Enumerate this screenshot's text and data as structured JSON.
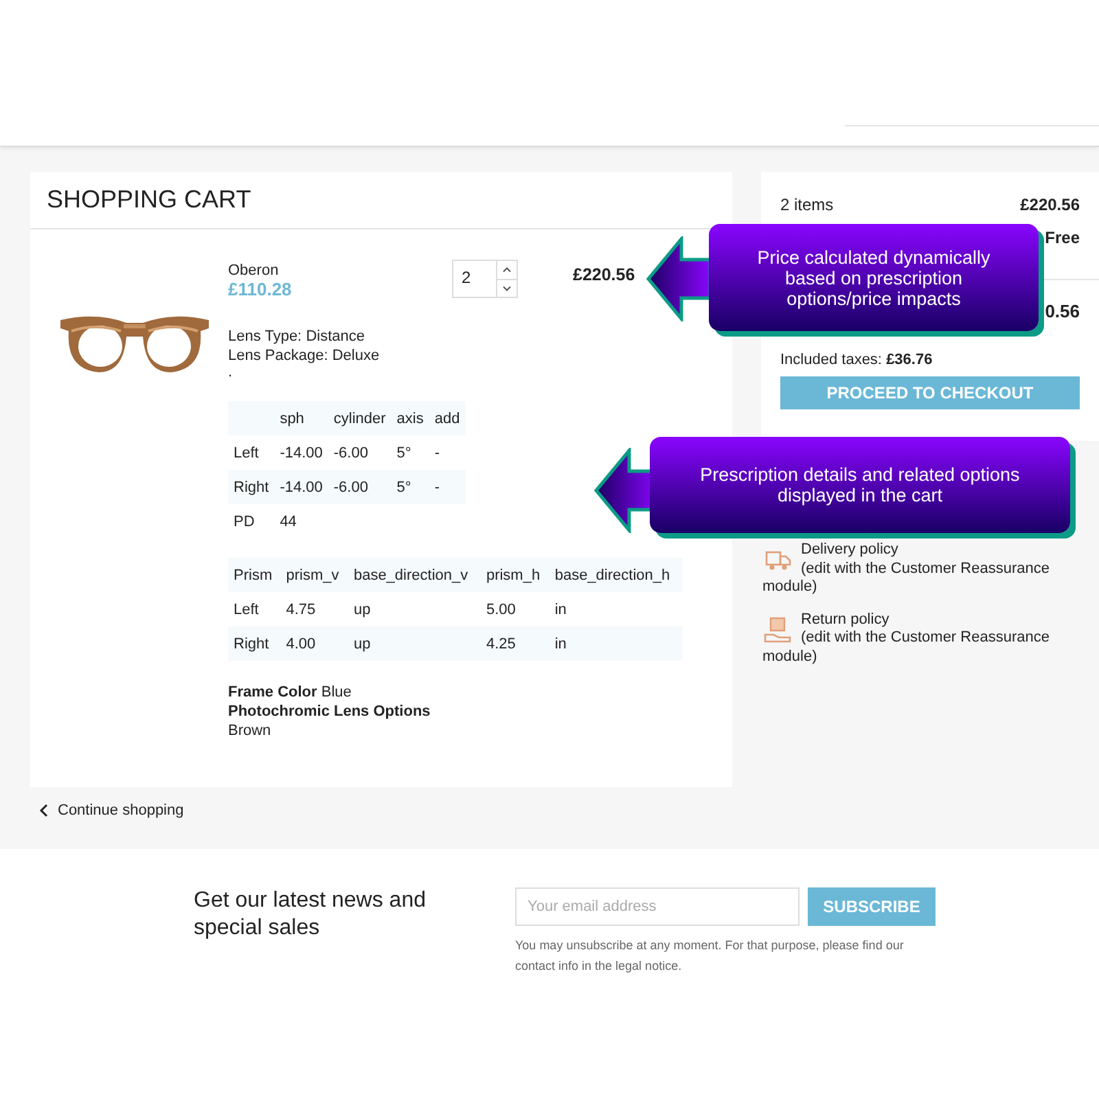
{
  "cart": {
    "title": "SHOPPING CART",
    "items": [
      {
        "name": "Oberon",
        "unit_price": "£110.28",
        "quantity": "2",
        "total": "£220.56",
        "attributes": [
          {
            "label": "Lens Type:",
            "value": "Distance"
          },
          {
            "label": "Lens Package:",
            "value": "Deluxe"
          }
        ],
        "separator": ".",
        "prescription": {
          "columns": [
            "sph",
            "cylinder",
            "axis",
            "add"
          ],
          "rows": [
            {
              "eye": "Left",
              "values": [
                "-14.00",
                "-6.00",
                "5°",
                "-"
              ]
            },
            {
              "eye": "Right",
              "values": [
                "-14.00",
                "-6.00",
                "5°",
                "-"
              ]
            }
          ],
          "pd": {
            "label": "PD",
            "value": "44"
          }
        },
        "prism": {
          "columns": [
            "Prism",
            "prism_v",
            "base_direction_v",
            "prism_h",
            "base_direction_h"
          ],
          "rows": [
            [
              "Left",
              "4.75",
              "up",
              "5.00",
              "in"
            ],
            [
              "Right",
              "4.00",
              "up",
              "4.25",
              "in"
            ]
          ]
        },
        "options": [
          {
            "kind": "inline",
            "label": "Frame Color",
            "value": "Blue"
          },
          {
            "kind": "block",
            "label": "Photochromic Lens Options",
            "value": "Brown"
          }
        ]
      }
    ]
  },
  "continue_link": "Continue shopping",
  "summary": {
    "rows": [
      {
        "kind": "items",
        "label": "2 items",
        "value": "£220.56"
      },
      {
        "kind": "shipping",
        "value": "Free"
      },
      {
        "kind": "total",
        "value": "0.56"
      }
    ],
    "taxes_label": "Included taxes:",
    "taxes_value": "£36.76",
    "checkout": "PROCEED TO CHECKOUT"
  },
  "reassurance": [
    {
      "kind": "delivery",
      "title": "Delivery policy",
      "note": "(edit with the Customer Reassurance module)"
    },
    {
      "kind": "return",
      "title": "Return policy",
      "note": "(edit with the Customer Reassurance module)"
    }
  ],
  "newsletter": {
    "heading": "Get our latest news and special sales",
    "placeholder": "Your email address",
    "button": "SUBSCRIBE",
    "note": "You may unsubscribe at any moment. For that purpose, please find our contact info in the legal notice."
  },
  "callouts": [
    {
      "text": "Price calculated dynamically based on prescription options/price impacts"
    },
    {
      "text": "Prescription details and related options displayed in the cart"
    }
  ]
}
